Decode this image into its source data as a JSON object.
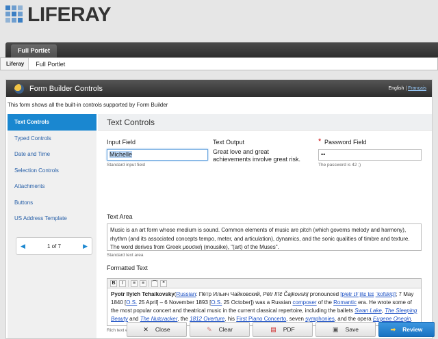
{
  "app": {
    "logo_text": "LIFERAY"
  },
  "dockbar": {
    "tab_label": "Full Portlet"
  },
  "breadcrumb": {
    "root": "Liferay",
    "current": "Full Portlet"
  },
  "portlet": {
    "title": "Form Builder Controls",
    "lang_current": "English",
    "lang_sep": " | ",
    "lang_other": "Français",
    "intro": "This form shows all the built-in controls supported by Form Builder"
  },
  "sidebar": {
    "items": [
      {
        "label": "Text Controls"
      },
      {
        "label": "Typed Controls"
      },
      {
        "label": "Date and Time"
      },
      {
        "label": "Selection Controls"
      },
      {
        "label": "Attachments"
      },
      {
        "label": "Buttons"
      },
      {
        "label": "US Address Template"
      }
    ],
    "pager": {
      "prev": "◀",
      "label": "1 of 7",
      "next": "▶"
    }
  },
  "main": {
    "title": "Text Controls",
    "input_field": {
      "label": "Input Field",
      "value": "Michelle",
      "help": "Standard input field"
    },
    "text_output": {
      "label": "Text Output",
      "value": "Great love and great achievements involve great risk."
    },
    "password_field": {
      "required": "*",
      "label": "Password Field",
      "value": "••",
      "help": "The password is 42 ;)"
    },
    "text_area": {
      "label": "Text Area",
      "value": "Music is an art form whose medium is sound. Common elements of music are pitch (which governs melody and harmony), rhythm (and its associated concepts tempo, meter, and articulation), dynamics, and the sonic qualities of timbre and texture. The word derives from Greek μουσική (mousike), \"(art) of the Muses\".",
      "help": "Standard text area"
    },
    "formatted_text": {
      "label": "Formatted Text",
      "toolbar": [
        "B",
        "I",
        "≡",
        "≡",
        "⌒",
        "❝"
      ],
      "help": "Rich text editor",
      "name": "Pyotr Ilyich Tchaikovsky",
      "lang_link": "Russian",
      "p1": ": Пётр Ильич Чайковский, ",
      "translit": "Pëtr Il'ič Čajkovskij",
      "p2": " pronounced ",
      "ipa": "[pʲɵtr ɪlʲˈjitɕ tɕɪ",
      "ipa2": "ˈkofskʲɪj]",
      "p3": "; 7 May 1840 ",
      "os1": "O.S.",
      "p4": " 25 April] – 6 November 1893 ",
      "os2": "O.S.",
      "p5": " 25 October]) was a Russian ",
      "composer": "composer",
      "p6": " of the ",
      "romantic": "Romantic",
      "p7": " era. He wrote some of the most popular concert and theatrical music in the current classical repertoire, including the ballets ",
      "swan": "Swan Lake",
      "c1": ", ",
      "sleeping": "The Sleeping Beauty",
      "and1": " and ",
      "nutcracker": "The Nutcracker",
      "c2": ", the ",
      "overture": "1812 Overture",
      "c3": ", his ",
      "concerto": "First Piano Concerto",
      "c4": ", seven ",
      "symphonies": "symphonies",
      "c5": ", and the opera ",
      "onegin": "Eugene Onegin",
      "end": "."
    }
  },
  "buttons": {
    "close": "Close",
    "clear": "Clear",
    "pdf": "PDF",
    "save": "Save",
    "review": "Review"
  },
  "colors": {
    "accent": "#1a87d0",
    "check": "#4a9a2c"
  }
}
